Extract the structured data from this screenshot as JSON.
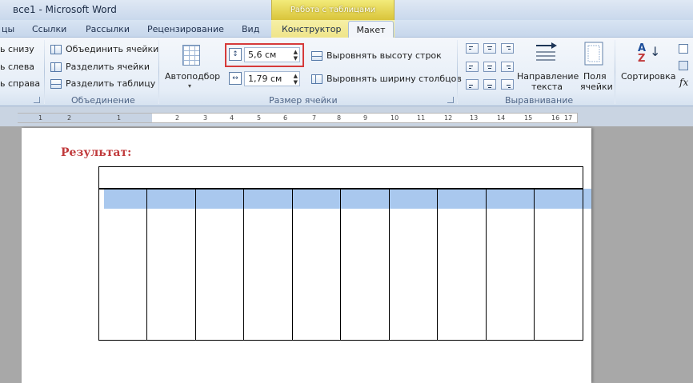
{
  "titlebar": {
    "title": "все1  -  Microsoft Word",
    "context_label": "Работа с таблицами"
  },
  "tabs": [
    {
      "label": "цы"
    },
    {
      "label": "Ссылки"
    },
    {
      "label": "Рассылки"
    },
    {
      "label": "Рецензирование"
    },
    {
      "label": "Вид"
    },
    {
      "label": "Конструктор"
    },
    {
      "label": "Макет"
    }
  ],
  "ribbon": {
    "insert_group": {
      "below": "ь снизу",
      "left": "ь слева",
      "right": "ь справа"
    },
    "merge_group": {
      "merge": "Объединить ячейки",
      "split_cells": "Разделить ячейки",
      "split_table": "Разделить таблицу",
      "label": "Объединение"
    },
    "cell_size": {
      "autofit": "Автоподбор",
      "height_value": "5,6 см",
      "width_value": "1,79 см",
      "distribute_rows": "Выровнять высоту строк",
      "distribute_cols": "Выровнять ширину столбцов",
      "label": "Размер ячейки"
    },
    "alignment": {
      "direction_line1": "Направление",
      "direction_line2": "текста",
      "margins_line1": "Поля",
      "margins_line2": "ячейки",
      "label": "Выравнивание"
    },
    "data": {
      "sort": "Сортировка",
      "sort_icon_a": "A",
      "sort_icon_z": "Z",
      "formula": "fx"
    }
  },
  "ruler": {
    "labels": [
      "1",
      "2",
      "1",
      "2",
      "3",
      "4",
      "5",
      "6",
      "7",
      "8",
      "9",
      "10",
      "11",
      "12",
      "13",
      "14",
      "15",
      "16",
      "17"
    ]
  },
  "document": {
    "result_label": "Результат:"
  },
  "colors": {
    "highlight_border": "#d63a3a",
    "selected_row": "#a9c8ee",
    "result_text": "#c0393b"
  }
}
